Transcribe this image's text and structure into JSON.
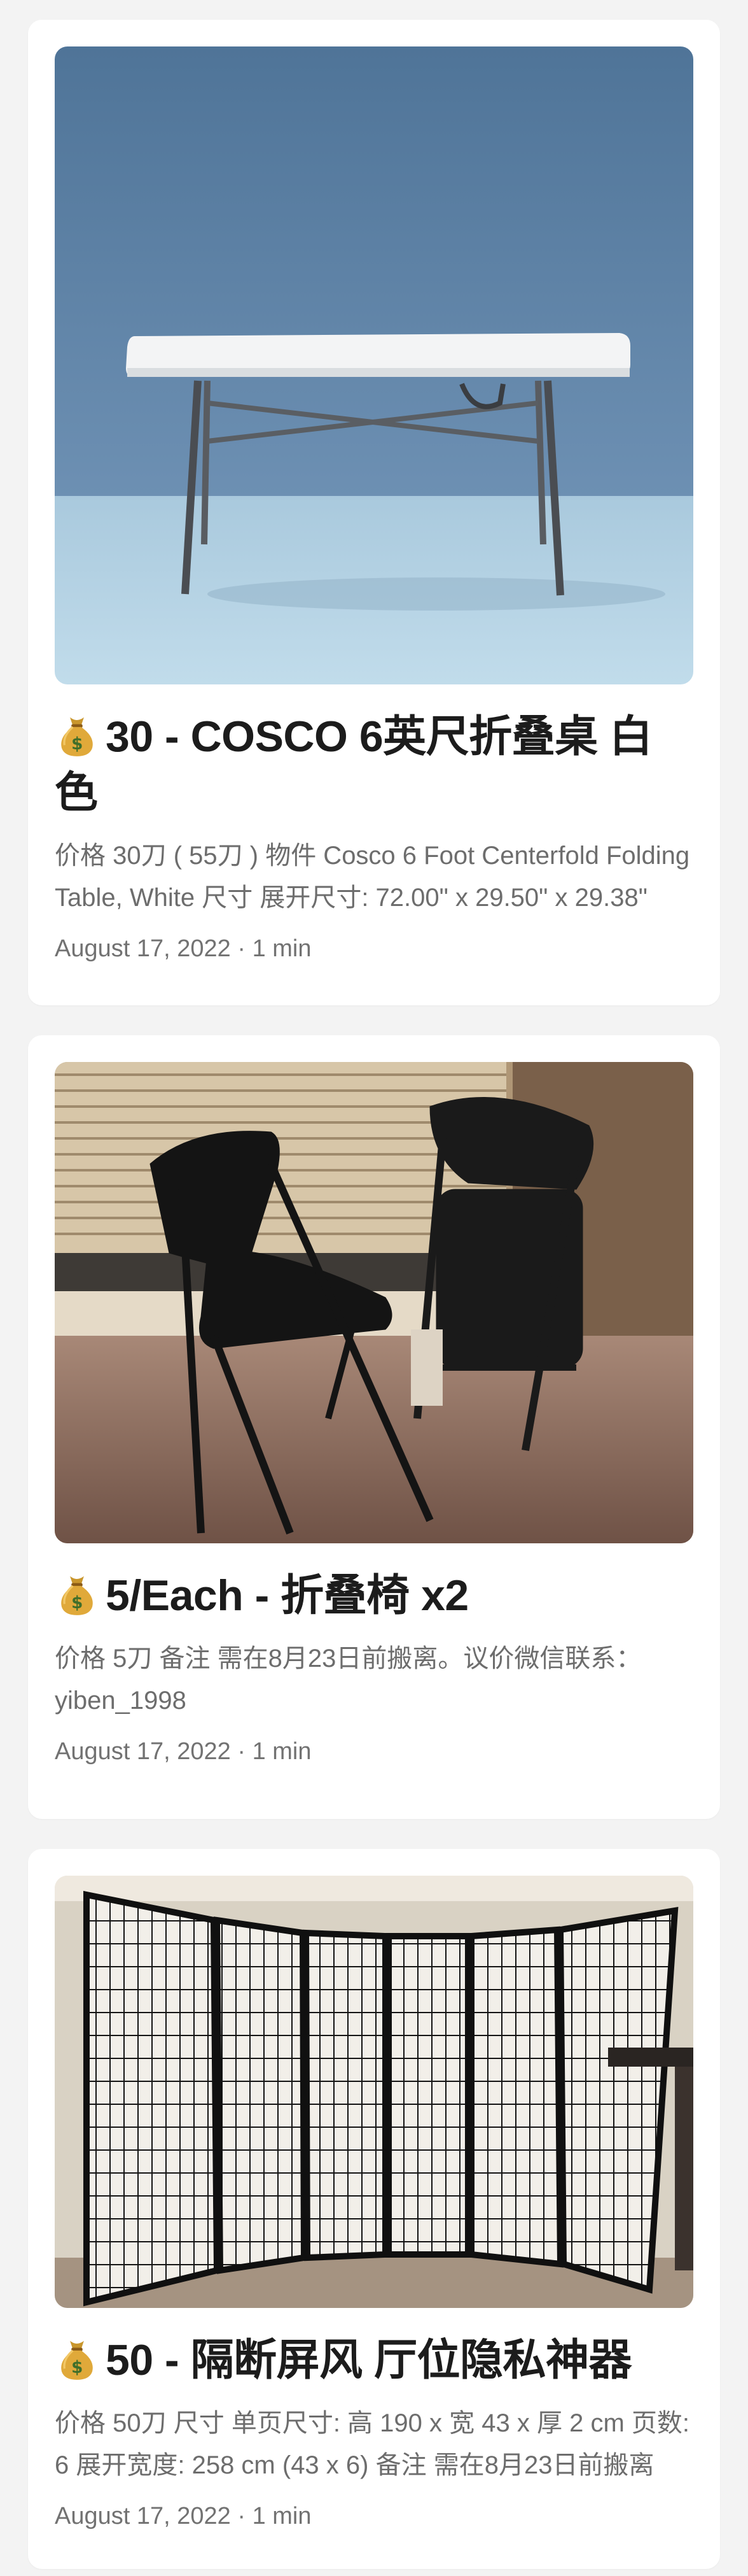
{
  "posts": [
    {
      "title": "30 - COSCO 6英尺折叠桌 白色",
      "excerpt": "价格 30刀 ( 55刀 ) 物件 Cosco 6 Foot Centerfold Folding Table, White 尺寸 展开尺寸: 72.00\" x 29.50\" x 29.38\"",
      "date": "August 17, 2022",
      "read_time": "1 min",
      "image": "white folding table on blue background",
      "emoji": "money-bag-icon"
    },
    {
      "title": "5/Each - 折叠椅 x2",
      "excerpt": "价格 5刀 备注 需在8月23日前搬离。议价微信联系：yiben_1998",
      "date": "August 17, 2022",
      "read_time": "1 min",
      "image": "two black folding chairs by a window",
      "emoji": "money-bag-icon"
    },
    {
      "title": "50 - 隔断屏风 厅位隐私神器",
      "excerpt": "价格 50刀 尺寸 单页尺寸: 高 190 x 宽 43 x 厚 2 cm 页数: 6 展开宽度: 258 cm (43 x 6) 备注 需在8月23日前搬离",
      "date": "August 17, 2022",
      "read_time": "1 min",
      "image": "six-panel black shoji room divider",
      "emoji": "money-bag-icon"
    }
  ],
  "meta_separator": " · ",
  "colors": {
    "page_bg": "#f3f3f3",
    "card_bg": "#ffffff",
    "title": "#1c1c1c",
    "excerpt": "#6d6d6d",
    "meta": "#727272"
  }
}
